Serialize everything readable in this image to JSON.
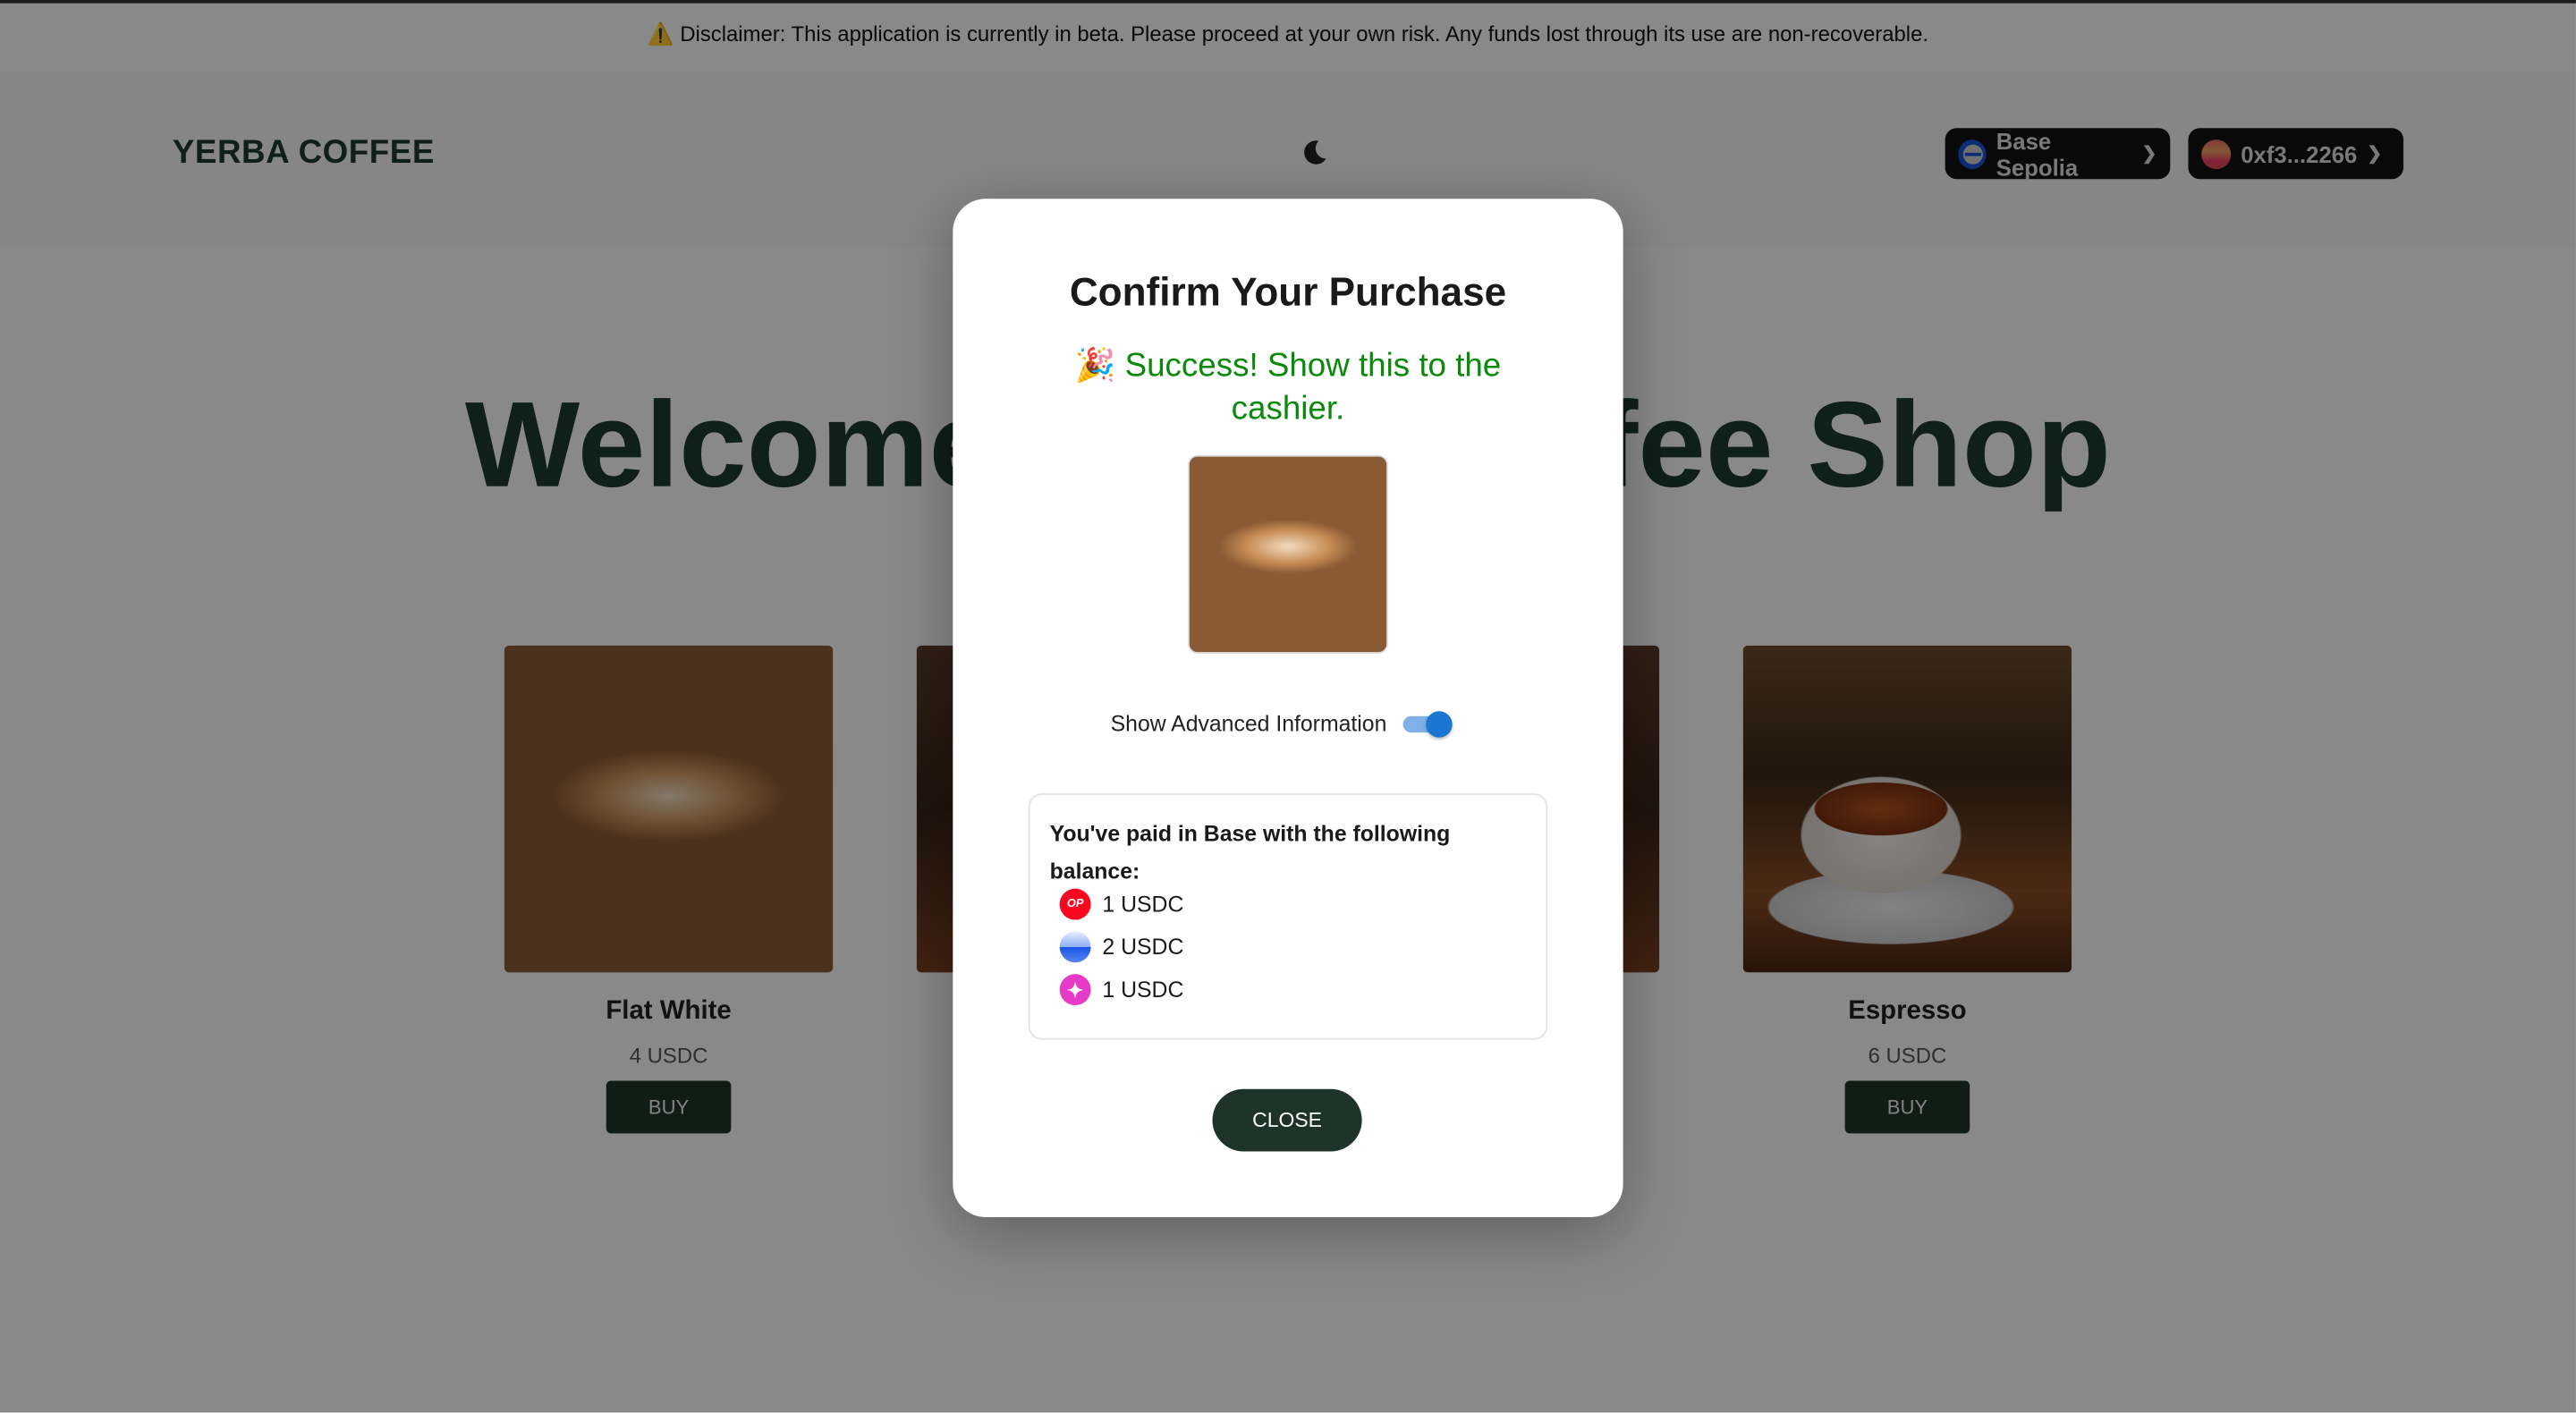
{
  "disclaimer": {
    "icon": "warning-icon",
    "glyph": "⚠️",
    "text": "Disclaimer: This application is currently in beta. Please proceed at your own risk. Any funds lost through its use are non-recoverable."
  },
  "header": {
    "logo": "YERBA COFFEE",
    "theme_icon": "moon-icon",
    "network": "Base Sepolia",
    "account": "0xf3...2266",
    "chevron": "⌄"
  },
  "hero": {
    "title": "Welcome to the Coffee Shop"
  },
  "products": [
    {
      "name": "Flat White",
      "price": "4 USDC",
      "buy": "BUY"
    },
    {
      "name": "Espresso",
      "price": "6 USDC",
      "buy": "BUY"
    }
  ],
  "modal": {
    "title": "Confirm Your Purchase",
    "success_emoji": "🎉",
    "success": "Success! Show this to the cashier.",
    "advanced_label": "Show Advanced Information",
    "advanced_on": true,
    "paid_text": "You've paid in Base with the following balance:",
    "balances": [
      {
        "token": "op-icon",
        "glyph": "OP",
        "amount": "1 USDC"
      },
      {
        "token": "base-icon",
        "glyph": "",
        "amount": "2 USDC"
      },
      {
        "token": "zora-icon",
        "glyph": "✦",
        "amount": "1 USDC"
      }
    ],
    "close": "CLOSE"
  },
  "colors": {
    "brand": "#1e3329",
    "success": "#0a8a0a",
    "toggle": "#1a76d2"
  }
}
